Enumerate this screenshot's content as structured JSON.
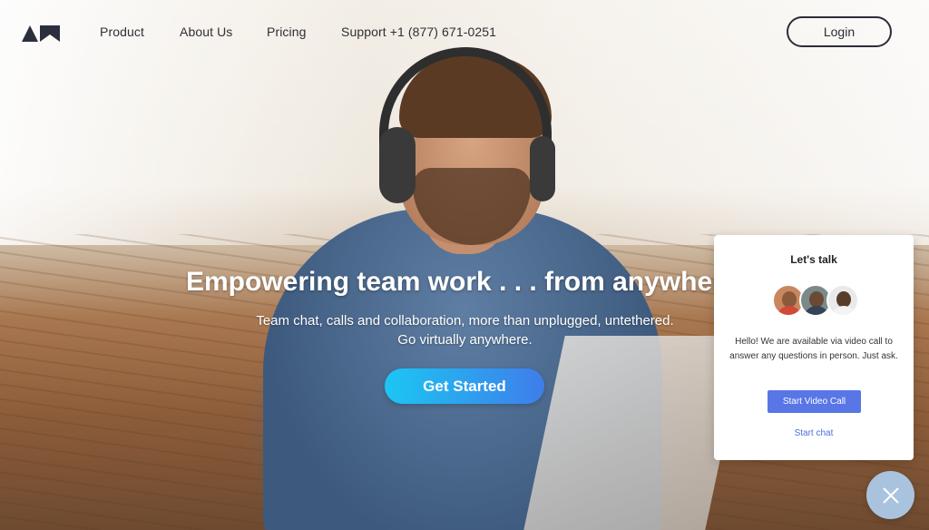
{
  "nav": {
    "logo_icon": "am-logo-icon",
    "links": [
      "Product",
      "About Us",
      "Pricing",
      "Support +1 (877) 671-0251"
    ],
    "login_label": "Login"
  },
  "hero": {
    "headline": "Empowering team work . . . from anywhere",
    "subline_1": "Team chat, calls and collaboration, more than unplugged, untethered.",
    "subline_2": "Go virtually anywhere.",
    "cta_label": "Get Started"
  },
  "chat_widget": {
    "title": "Let's talk",
    "message": "Hello! We are available via video call to answer any questions in person. Just ask.",
    "video_button": "Start Video Call",
    "chat_link": "Start chat",
    "close_icon": "close-icon"
  },
  "colors": {
    "cta_start": "#1cc6f3",
    "cta_end": "#3f7dea",
    "video_button": "#5876e6",
    "link": "#4a6fe0",
    "close_fab": "#a9c3df"
  }
}
